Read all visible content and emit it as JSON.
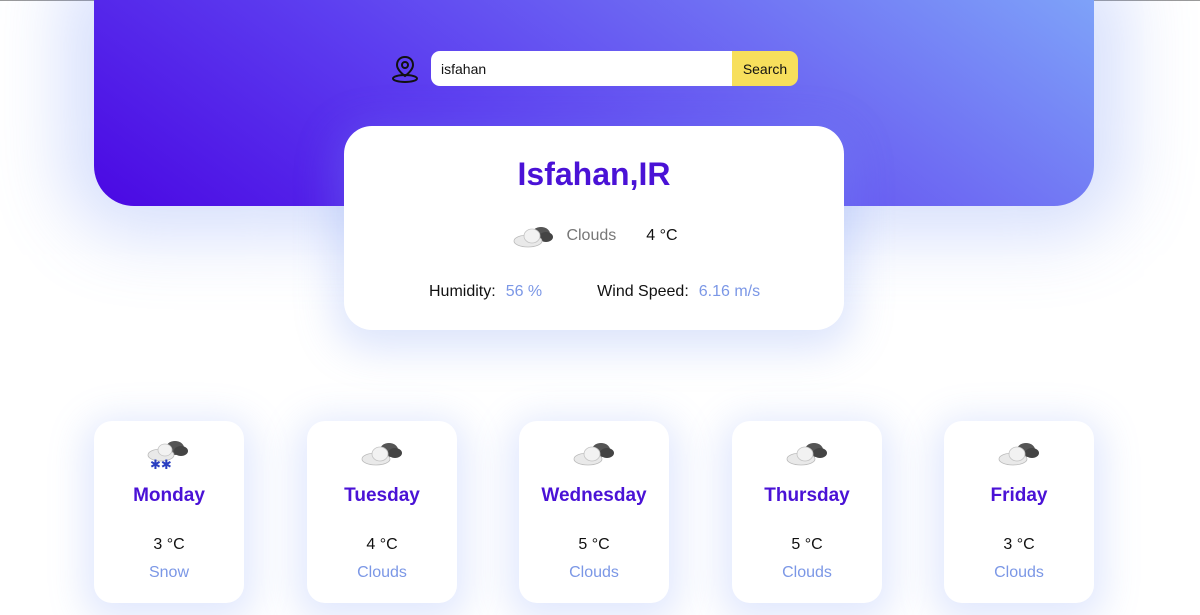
{
  "search": {
    "value": "isfahan",
    "button_label": "Search",
    "icon": "location-pin-icon"
  },
  "current": {
    "city": "Isfahan,IR",
    "condition": "Clouds",
    "condition_icon": "cloud-icon",
    "temp": "4 °C",
    "humidity_label": "Humidity:",
    "humidity_value": "56 %",
    "wind_label": "Wind Speed:",
    "wind_value": "6.16 m/s"
  },
  "forecast": [
    {
      "day": "Monday",
      "temp": "3 °C",
      "condition": "Snow",
      "icon": "snow-cloud-icon"
    },
    {
      "day": "Tuesday",
      "temp": "4 °C",
      "condition": "Clouds",
      "icon": "cloud-icon"
    },
    {
      "day": "Wednesday",
      "temp": "5 °C",
      "condition": "Clouds",
      "icon": "cloud-icon"
    },
    {
      "day": "Thursday",
      "temp": "5 °C",
      "condition": "Clouds",
      "icon": "cloud-icon"
    },
    {
      "day": "Friday",
      "temp": "3 °C",
      "condition": "Clouds",
      "icon": "cloud-icon"
    }
  ],
  "colors": {
    "accent": "#4a12d6",
    "search_button": "#f7df5c",
    "value_blue": "#7b97e6"
  }
}
